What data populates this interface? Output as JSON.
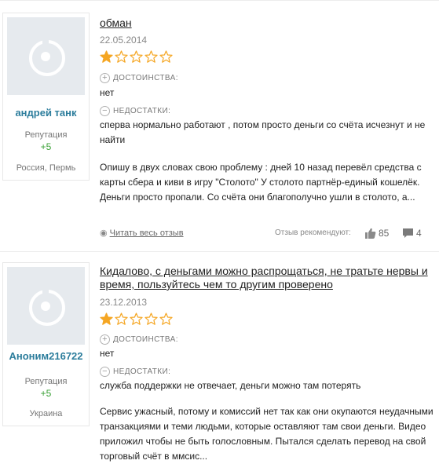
{
  "colors": {
    "username": "#2c7d9c",
    "reputation_value": "#3aa136",
    "star_filled": "#f5a623",
    "star_empty": "#f5a623"
  },
  "reviews": [
    {
      "user": {
        "name": "андрей танк",
        "reputation_label": "Репутация",
        "reputation_value": "+5",
        "location": "Россия, Пермь"
      },
      "title": "обман",
      "date": "22.05.2014",
      "rating": 1,
      "rating_max": 5,
      "pros_label": "ДОСТОИНСТВА:",
      "pros_text": "нет",
      "cons_label": "НЕДОСТАТКИ:",
      "cons_text": "сперва нормально работают , потом просто деньги со счёта исчезнут и не найти",
      "body": "Опишу в двух словах свою проблему : дней 10 назад перевёл средства с карты сбера и киви в игру \"Столото\" У столото партнёр-единый кошелёк. Деньги просто пропали. Со счёта они благополучно ушли в столото, а...",
      "read_more": "Читать весь отзыв",
      "recommend_label": "Отзыв рекомендуют:",
      "likes": "85",
      "comments": "4"
    },
    {
      "user": {
        "name": "Аноним216722",
        "reputation_label": "Репутация",
        "reputation_value": "+5",
        "location": "Украина"
      },
      "title": "Кидалово, с деньгами можно распрощаться, не тратьте нервы и время, пользуйтесь чем то другим проверено",
      "date": "23.12.2013",
      "rating": 1,
      "rating_max": 5,
      "pros_label": "ДОСТОИНСТВА:",
      "pros_text": "нет",
      "cons_label": "НЕДОСТАТКИ:",
      "cons_text": "служба поддержки не отвечает, деньги можно там потерять",
      "body": "Сервис ужасный, потому и комиссий нет так как они окупаются неудачными транзакциями и теми людьми, которые оставляют там свои деньги. Видео приложил чтобы не быть голословным. Пытался сделать перевод на свой торговый счёт в ммсис..."
    }
  ]
}
